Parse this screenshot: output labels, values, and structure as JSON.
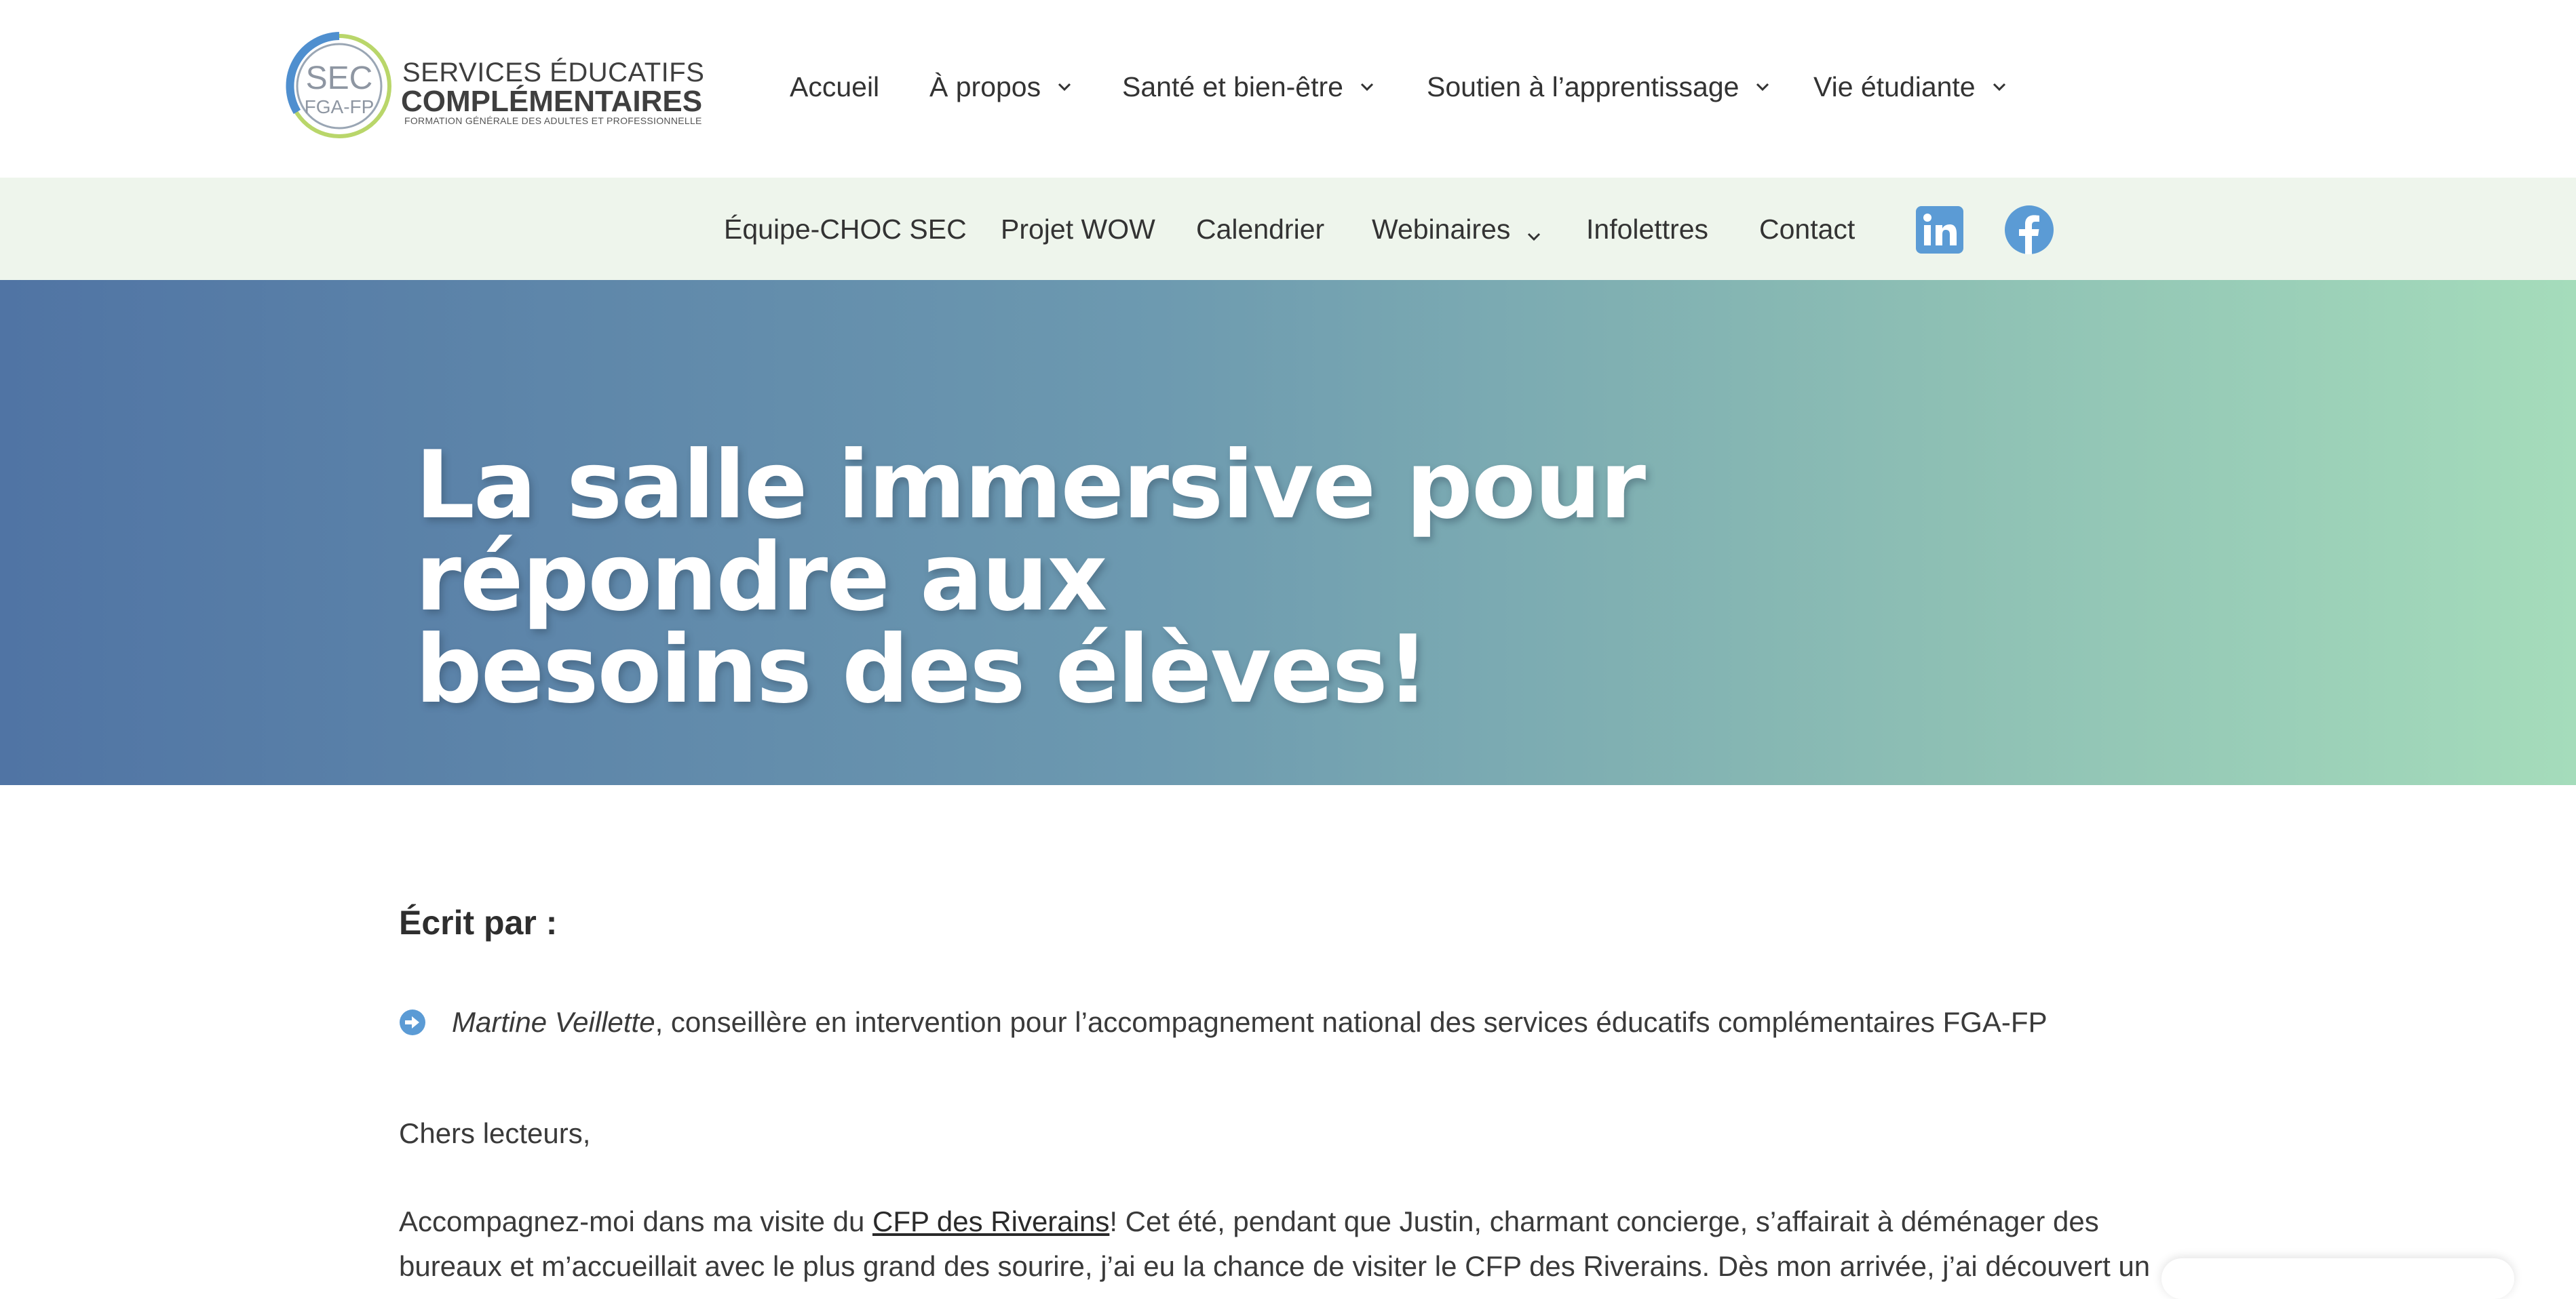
{
  "header": {
    "logo": {
      "mark_top": "SEC",
      "mark_bottom": "FGA-FP",
      "line1": "SERVICES ÉDUCATIFS",
      "line2": "COMPLÉMENTAIRES",
      "line3": "FORMATION GÉNÉRALE DES ADULTES ET PROFESSIONNELLE"
    },
    "nav": [
      {
        "label": "Accueil",
        "has_dropdown": false
      },
      {
        "label": "À propos",
        "has_dropdown": true
      },
      {
        "label": "Santé et bien-être",
        "has_dropdown": true
      },
      {
        "label": "Soutien à l’apprentissage",
        "has_dropdown": true
      },
      {
        "label": "Vie étudiante",
        "has_dropdown": true
      }
    ]
  },
  "subnav": {
    "items": [
      {
        "label": "Équipe-CHOC SEC",
        "has_dropdown": false
      },
      {
        "label": "Projet WOW",
        "has_dropdown": false
      },
      {
        "label": "Calendrier",
        "has_dropdown": false
      },
      {
        "label": "Webinaires",
        "has_dropdown": true
      },
      {
        "label": "Infolettres",
        "has_dropdown": false
      },
      {
        "label": "Contact",
        "has_dropdown": false
      }
    ],
    "social": [
      {
        "icon": "linkedin-icon",
        "color": "#5b9bd5"
      },
      {
        "icon": "facebook-icon",
        "color": "#5b9bd5"
      }
    ]
  },
  "hero": {
    "title_line1": "La salle immersive pour répondre aux",
    "title_line2": "besoins des élèves!"
  },
  "article": {
    "written_by_label": "Écrit par :",
    "author_name": "Martine Veillette",
    "author_role": ", conseillère en intervention pour l’accompagnement national des services éducatifs complémentaires FGA-FP",
    "greeting": "Chers lecteurs,",
    "para1_before": "Accompagnez-moi dans ma visite du ",
    "para1_link": "CFP des Riverains",
    "para1_after": "! Cet été, pendant que Justin, charmant concierge, s’affairait à déménager des",
    "para2": "bureaux et m’accueillait avec le plus grand des sourire, j’ai eu la chance de visiter le CFP des Riverains. Dès mon arrivée, j’ai découvert un"
  },
  "colors": {
    "accent": "#5b9bd5",
    "subbar_bg": "#eef5ec",
    "hero_start": "#5074a4",
    "hero_end": "#a5dcbb"
  }
}
